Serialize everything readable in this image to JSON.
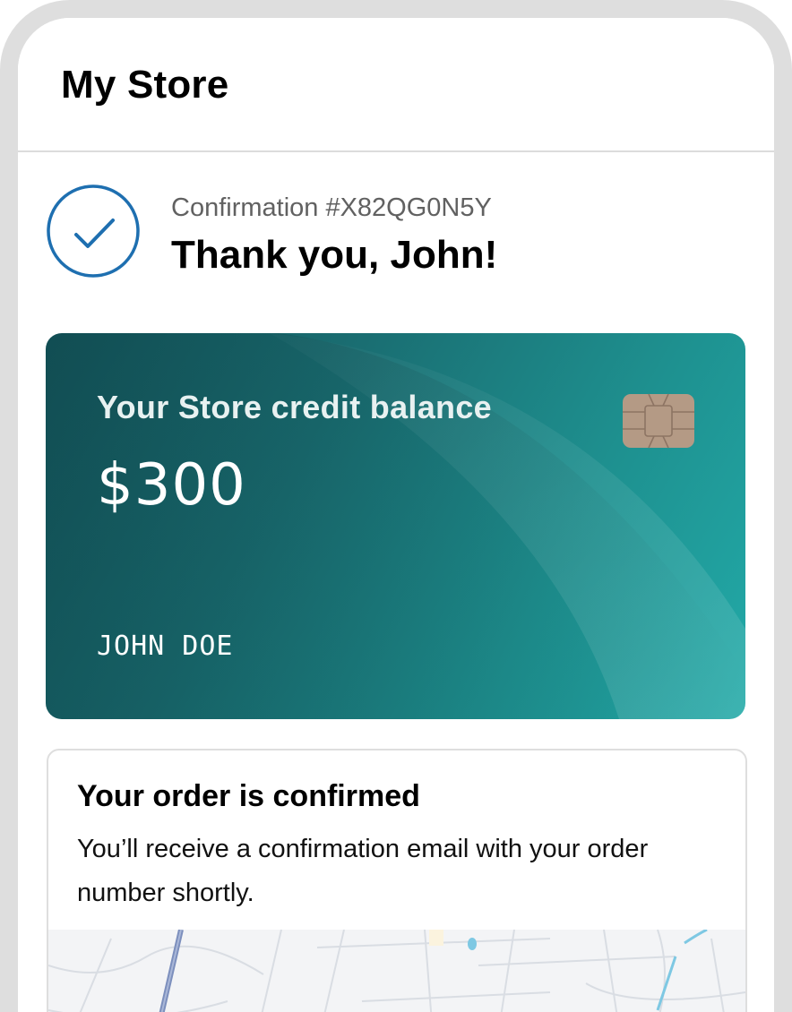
{
  "header": {
    "title": "My Store"
  },
  "confirmation": {
    "number_text": "Confirmation #X82QG0N5Y",
    "heading": "Thank you, John!"
  },
  "credit_card": {
    "label": "Your Store credit balance",
    "balance": "$300",
    "holder": "JOHN DOE"
  },
  "order": {
    "title": "Your order is confirmed",
    "description": "You’ll receive a confirmation email with your order number shortly."
  },
  "colors": {
    "accent_check": "#1e6fb0",
    "card_dark": "#14555b",
    "card_light": "#22aaa8",
    "chip": "#b49a85"
  },
  "icons": {
    "check": "checkmark-circle-icon",
    "chip": "card-chip-icon"
  }
}
